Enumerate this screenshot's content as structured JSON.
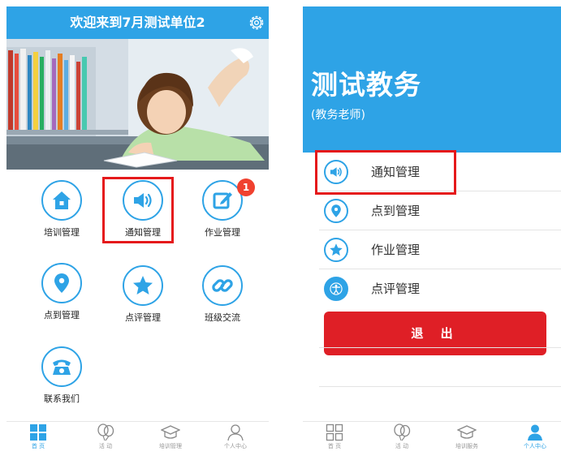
{
  "left": {
    "header": {
      "title": "欢迎来到7月测试单位2",
      "settings_icon": "gear-icon"
    },
    "grid": [
      {
        "label": "培训管理",
        "icon": "house-icon"
      },
      {
        "label": "通知管理",
        "icon": "speaker-icon"
      },
      {
        "label": "作业管理",
        "icon": "edit-icon",
        "badge": "1"
      },
      {
        "label": "点到管理",
        "icon": "location-pin-icon"
      },
      {
        "label": "点评管理",
        "icon": "star-icon"
      },
      {
        "label": "班级交流",
        "icon": "link-icon"
      },
      {
        "label": "联系我们",
        "icon": "telephone-icon"
      }
    ],
    "tabs": [
      {
        "label": "首 页",
        "icon": "grid-icon"
      },
      {
        "label": "活 动",
        "icon": "balloon-icon"
      },
      {
        "label": "培训管理",
        "icon": "graduation-cap-icon"
      },
      {
        "label": "个人中心",
        "icon": "person-icon"
      }
    ],
    "active_tab": "首 页"
  },
  "right": {
    "profile": {
      "name": "测试教务",
      "role": "(教务老师)"
    },
    "menu": [
      {
        "label": "通知管理",
        "icon": "speaker-icon"
      },
      {
        "label": "点到管理",
        "icon": "location-pin-icon"
      },
      {
        "label": "作业管理",
        "icon": "star-icon"
      },
      {
        "label": "点评管理",
        "icon": "accessibility-icon"
      }
    ],
    "logout_label": "退 出",
    "tabs": [
      {
        "label": "首 页",
        "icon": "grid-icon"
      },
      {
        "label": "活 动",
        "icon": "balloon-icon"
      },
      {
        "label": "培训服务",
        "icon": "graduation-cap-icon"
      },
      {
        "label": "个人中心",
        "icon": "person-icon"
      }
    ],
    "active_tab": "个人中心"
  },
  "colors": {
    "primary": "#2ea3e6",
    "highlight": "#e5191b",
    "logout": "#df1f26",
    "badge": "#f0412f"
  }
}
